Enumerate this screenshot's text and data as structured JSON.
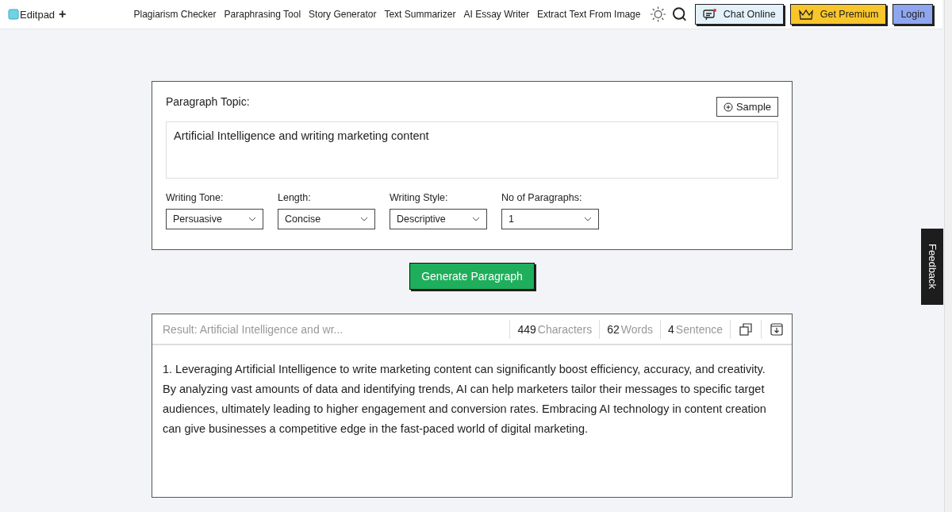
{
  "header": {
    "logo": "Editpad",
    "logo_plus": "+",
    "nav": [
      "Plagiarism Checker",
      "Paraphrasing Tool",
      "Story Generator",
      "Text Summarizer",
      "AI Essay Writer",
      "Extract Text From Image"
    ],
    "chat_button": "Chat Online",
    "premium_button": "Get Premium",
    "login_button": "Login"
  },
  "form": {
    "topic_label": "Paragraph Topic:",
    "sample_button": "Sample",
    "topic_value": "Artificial Intelligence and writing marketing content",
    "selects": [
      {
        "label": "Writing Tone:",
        "value": "Persuasive"
      },
      {
        "label": "Length:",
        "value": "Concise"
      },
      {
        "label": "Writing Style:",
        "value": "Descriptive"
      },
      {
        "label": "No of Paragraphs:",
        "value": "1"
      }
    ]
  },
  "generate_button": "Generate Paragraph",
  "result": {
    "title": "Result: Artificial Intelligence and wr...",
    "stats": [
      {
        "count": "449",
        "label": "Characters"
      },
      {
        "count": "62",
        "label": "Words"
      },
      {
        "count": "4",
        "label": "Sentence"
      }
    ],
    "text": "1. Leveraging Artificial Intelligence to write marketing content can significantly boost efficiency, accuracy, and creativity. By analyzing vast amounts of data and identifying trends, AI can help marketers tailor their messages to specific target audiences, ultimately leading to higher engagement and conversion rates. Embracing AI technology in content creation can give businesses a competitive edge in the fast-paced world of digital marketing."
  },
  "feedback_tab": "Feedback"
}
